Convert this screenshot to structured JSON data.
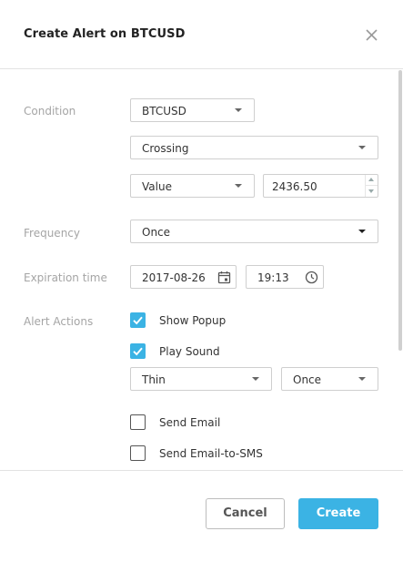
{
  "dialog": {
    "title": "Create Alert on BTCUSD"
  },
  "condition": {
    "label": "Condition",
    "symbol": "BTCUSD",
    "operator": "Crossing",
    "value_type": "Value",
    "value": "2436.50"
  },
  "frequency": {
    "label": "Frequency",
    "selected": "Once"
  },
  "expiration": {
    "label": "Expiration time",
    "date": "2017-08-26",
    "time": "19:13"
  },
  "actions": {
    "label": "Alert Actions",
    "show_popup": {
      "label": "Show Popup",
      "checked": true
    },
    "play_sound": {
      "label": "Play Sound",
      "checked": true
    },
    "sound_name": "Thin",
    "sound_repeat": "Once",
    "send_email": {
      "label": "Send Email",
      "checked": false
    },
    "send_email_sms": {
      "label": "Send Email-to-SMS",
      "checked": false
    }
  },
  "footer": {
    "cancel_label": "Cancel",
    "create_label": "Create"
  },
  "colors": {
    "accent": "#3bb3e4",
    "label_gray": "#a5a5a5",
    "border": "#cfcfcf"
  },
  "icons": {
    "close": "close-icon",
    "dropdown": "chevron-down-icon",
    "calendar": "calendar-icon",
    "clock": "clock-icon",
    "check": "check-icon"
  }
}
